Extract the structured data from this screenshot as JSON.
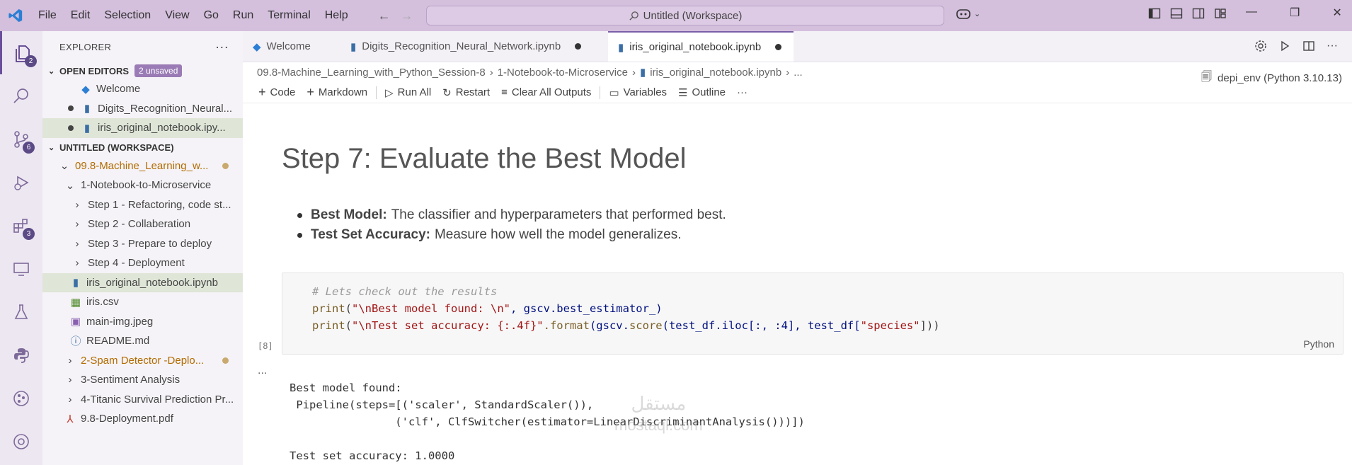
{
  "titlebar": {
    "menus": [
      "File",
      "Edit",
      "Selection",
      "View",
      "Go",
      "Run",
      "Terminal",
      "Help"
    ],
    "search": "Untitled (Workspace)"
  },
  "activity": {
    "explorer_badge": "2",
    "scm_badge": "6",
    "extensions_badge": "3"
  },
  "sidebar": {
    "title": "EXPLORER",
    "open_editors": {
      "label": "OPEN EDITORS",
      "unsaved": "2 unsaved",
      "items": [
        "Welcome",
        "Digits_Recognition_Neural...",
        "iris_original_notebook.ipy..."
      ]
    },
    "workspace": {
      "label": "UNTITLED (WORKSPACE)",
      "root": "09.8-Machine_Learning_w...",
      "folder": "1-Notebook-to-Microservice",
      "steps": [
        "Step 1 - Refactoring, code st...",
        "Step 2 - Collaberation",
        "Step 3 - Prepare to deploy",
        "Step 4 - Deployment"
      ],
      "files": [
        "iris_original_notebook.ipynb",
        "iris.csv",
        "main-img.jpeg",
        "README.md"
      ],
      "folders": [
        "2-Spam Detector -Deplo...",
        "3-Sentiment Analysis",
        "4-Titanic Survival Prediction Pr..."
      ],
      "pdf": "9.8-Deployment.pdf"
    }
  },
  "tabs": [
    "Welcome",
    "Digits_Recognition_Neural_Network.ipynb",
    "iris_original_notebook.ipynb"
  ],
  "breadcrumb": {
    "parts": [
      "09.8-Machine_Learning_with_Python_Session-8",
      "1-Notebook-to-Microservice",
      "iris_original_notebook.ipynb",
      "..."
    ]
  },
  "toolbar": {
    "code": "Code",
    "markdown": "Markdown",
    "run_all": "Run All",
    "restart": "Restart",
    "clear": "Clear All Outputs",
    "variables": "Variables",
    "outline": "Outline",
    "more": "···",
    "kernel": "depi_env (Python 3.10.13)"
  },
  "notebook": {
    "heading": "Step 7: Evaluate the Best Model",
    "bullets": [
      {
        "bold": "Best Model:",
        "text": "The classifier and hyperparameters that performed best."
      },
      {
        "bold": "Test Set Accuracy:",
        "text": "Measure how well the model generalizes."
      }
    ],
    "cell": {
      "exec_count": "[8]",
      "language": "Python",
      "comment": "# Lets check out the results",
      "line2": {
        "kw": "print",
        "str": "\"\\nBest model found: \\n\"",
        "rest": ", gscv.best_estimator_)"
      },
      "line3": {
        "kw": "print",
        "str": "\"\\nTest set accuracy: {:.4f}\"",
        "fmt": ".format",
        "open": "(gscv.",
        "score": "score",
        "rest": "(test_df.iloc[:, :4], test_df[",
        "species": "\"species\"",
        "close": "]))"
      }
    },
    "output_more": "...",
    "output": "Best model found:\n Pipeline(steps=[('scaler', StandardScaler()),\n                ('clf', ClfSwitcher(estimator=LinearDiscriminantAnalysis()))])\n\nTest set accuracy: 1.0000"
  },
  "watermark": {
    "arabic": "مستقل",
    "latin": "mostaql.com"
  }
}
